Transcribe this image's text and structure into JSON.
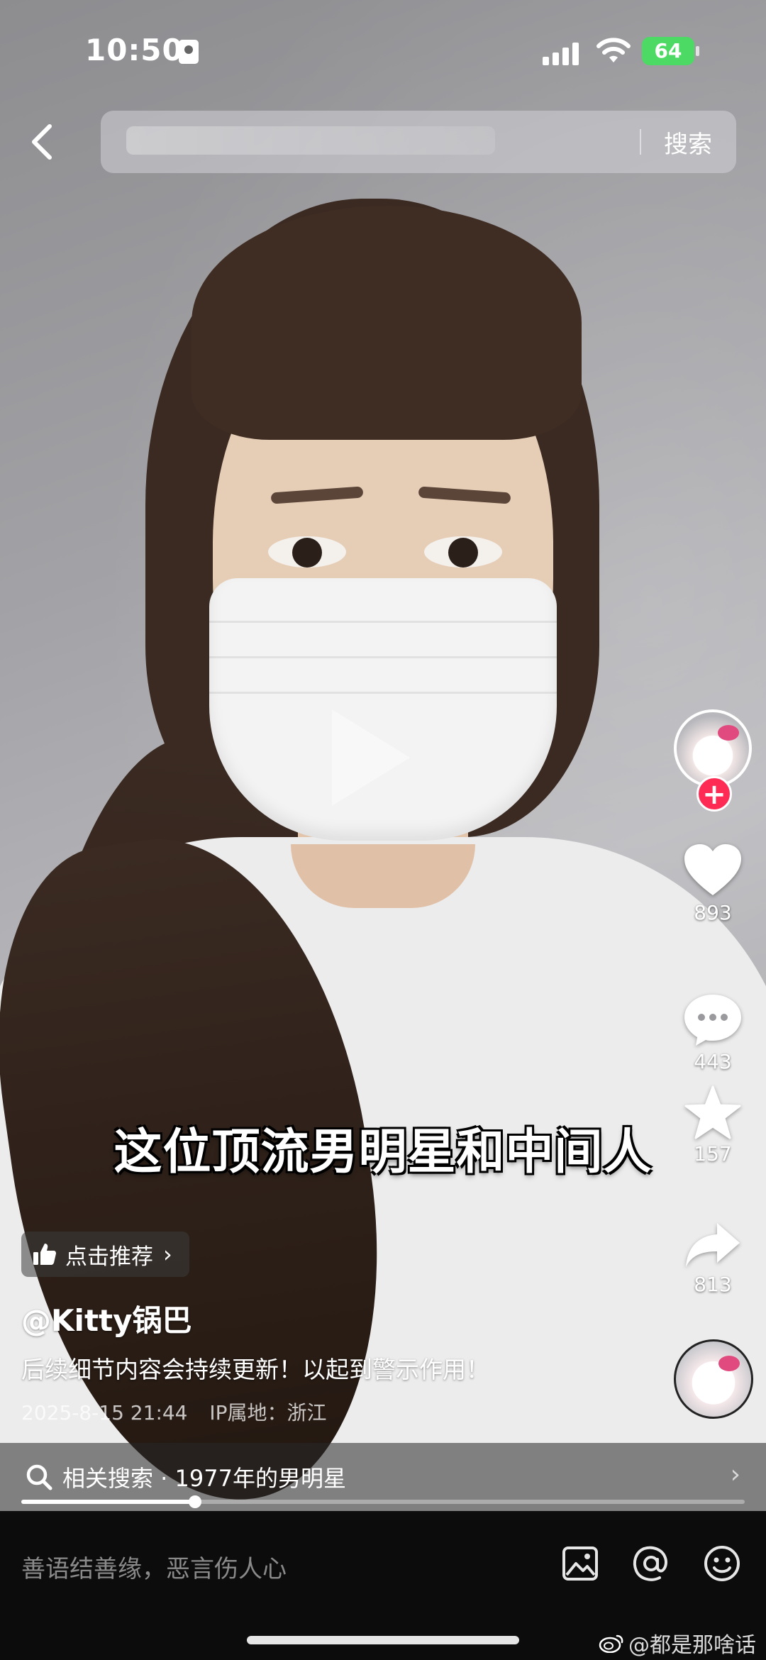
{
  "status_bar": {
    "time": "10:50",
    "battery": "64"
  },
  "search": {
    "button_label": "搜索"
  },
  "video": {
    "caption": "这位顶流男明星和中间人"
  },
  "rail": {
    "like_count": "893",
    "comment_count": "443",
    "favorite_count": "157",
    "share_count": "813",
    "follow_symbol": "+"
  },
  "info": {
    "recommend_label": "点击推荐",
    "author": "@Kitty锅巴",
    "description": "后续细节内容会持续更新！以起到警示作用！",
    "date": "2025-8-15 21:44",
    "ip_location": "IP属地：浙江"
  },
  "related": {
    "label": "相关搜索 · 1977年的男明星"
  },
  "progress": {
    "fraction": 0.24
  },
  "comment_bar": {
    "placeholder": "善语结善缘，恶言伤人心"
  },
  "watermark": {
    "text": "@都是那啥话"
  },
  "icons": [
    "back-icon",
    "search-icon",
    "heart-icon",
    "comment-icon",
    "star-icon",
    "share-icon",
    "thumbs-up-icon",
    "image-icon",
    "at-icon",
    "emoji-icon",
    "signal-icon",
    "wifi-icon",
    "battery-icon",
    "weibo-icon"
  ],
  "colors": {
    "accent": "#fe2c55",
    "battery": "#4cd964"
  }
}
